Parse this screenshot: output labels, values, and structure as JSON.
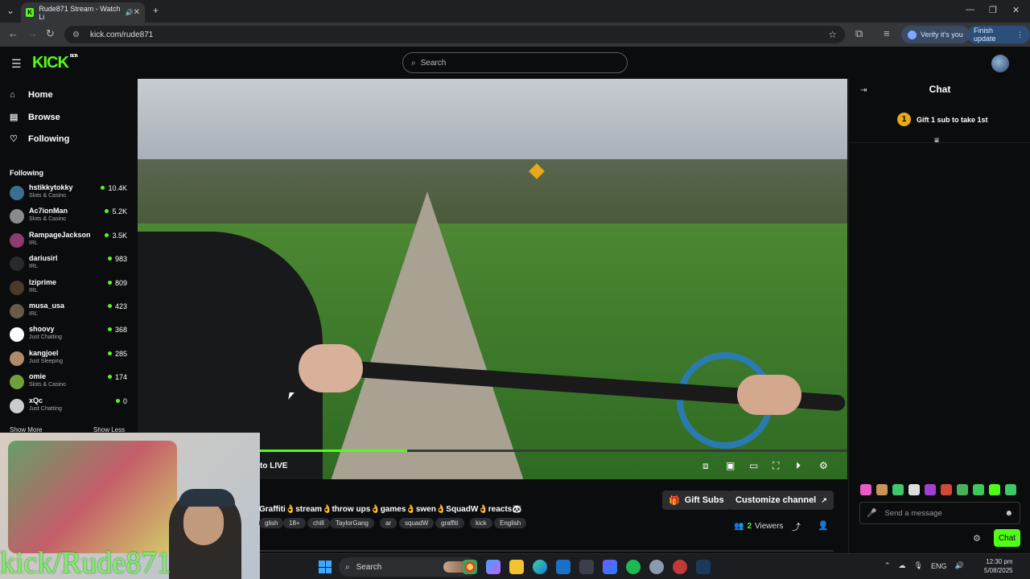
{
  "browser": {
    "tab_title": "Rude871 Stream - Watch Li",
    "tab_favicon": "K",
    "url": "kick.com/rude871",
    "verify_label": "Verify it's you",
    "finish_update_label": "Finish update"
  },
  "header": {
    "logo": "KICK",
    "logo_badge": "BETA",
    "search_placeholder": "Search"
  },
  "sidebar": {
    "nav": [
      {
        "label": "Home",
        "icon": "home-icon"
      },
      {
        "label": "Browse",
        "icon": "browse-icon"
      },
      {
        "label": "Following",
        "icon": "heart-icon"
      }
    ],
    "following_heading": "Following",
    "following": [
      {
        "name": "hstikkytokky",
        "category": "Slots & Casino",
        "viewers": "10.4K",
        "color": "#3b6e8f"
      },
      {
        "name": "Ac7ionMan",
        "category": "Slots & Casino",
        "viewers": "5.2K",
        "color": "#8a8a8a"
      },
      {
        "name": "RampageJackson",
        "category": "IRL",
        "viewers": "3.5K",
        "color": "#8f3b6e"
      },
      {
        "name": "dariusirl",
        "category": "IRL",
        "viewers": "983",
        "color": "#2a2a2a"
      },
      {
        "name": "lziprime",
        "category": "IRL",
        "viewers": "809",
        "color": "#4a3a2a"
      },
      {
        "name": "musa_usa",
        "category": "IRL",
        "viewers": "423",
        "color": "#6a5a4a"
      },
      {
        "name": "shoovy",
        "category": "Just Chatting",
        "viewers": "368",
        "color": "#ffffff"
      },
      {
        "name": "kangjoel",
        "category": "Just Sleeping",
        "viewers": "285",
        "color": "#b08a6a"
      },
      {
        "name": "omie",
        "category": "Slots & Casino",
        "viewers": "174",
        "color": "#6fa03a"
      },
      {
        "name": "xQc",
        "category": "Just Chatting",
        "viewers": "0",
        "color": "#cccccc"
      }
    ],
    "show_more": "Show More",
    "show_less": "Show Less"
  },
  "player": {
    "live_label": "to LIVE",
    "progress": 0.25
  },
  "webcam": {
    "overlay_text": "kick/Rude871"
  },
  "stream": {
    "title": "Graffiti👌stream👌throw ups👌games👌swen👌SquadW👌reacts🐼",
    "tags": [
      "glish",
      "18+",
      "chill",
      "TaylorGang",
      "ar",
      "squadW",
      "graffiti",
      "kick",
      "English"
    ],
    "gift_subs_label": "Gift Subs",
    "customize_label": "Customize channel",
    "viewers_count": "2",
    "viewers_label": "Viewers"
  },
  "chat": {
    "title": "Chat",
    "gift_rank": "1",
    "gift_text": "Gift 1 sub to take 1st",
    "input_placeholder": "Send a message",
    "send_label": "Chat",
    "emote_colors": [
      "#e85ac8",
      "#c7945a",
      "#3fc76a",
      "#dddddd",
      "#a040d0",
      "#d04a3a",
      "#4ab05a",
      "#3fc75a",
      "#53fc18",
      "#3fc76a"
    ]
  },
  "taskbar": {
    "search_label": "Search",
    "lang": "ENG",
    "time": "12:30 pm",
    "date": "5/08/2025"
  },
  "colors": {
    "accent": "#53fc18",
    "background": "#0b0c0e"
  }
}
